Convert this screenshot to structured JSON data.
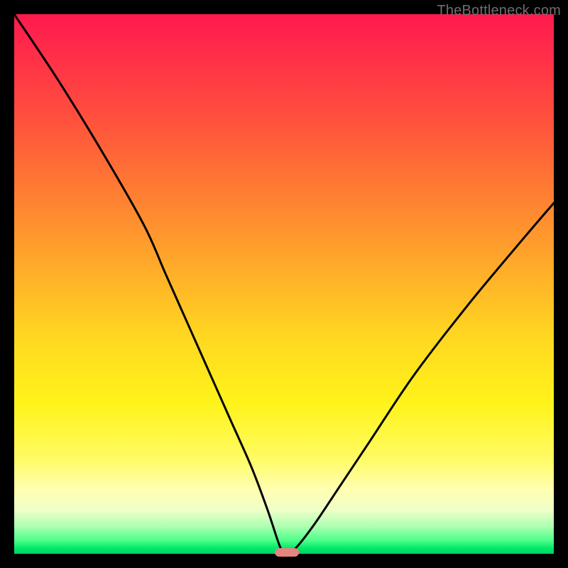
{
  "watermark": "TheBottleneck.com",
  "chart_data": {
    "type": "line",
    "title": "",
    "xlabel": "",
    "ylabel": "",
    "xlim": [
      0,
      100
    ],
    "ylim": [
      0,
      100
    ],
    "grid": false,
    "series": [
      {
        "name": "bottleneck-curve",
        "x": [
          0,
          8,
          16,
          24,
          28,
          32,
          36,
          40,
          44,
          47,
          49,
          50,
          51,
          53,
          56,
          60,
          66,
          74,
          84,
          94,
          100
        ],
        "values": [
          100,
          88,
          75,
          61,
          52,
          43,
          34,
          25,
          16,
          8,
          2,
          0,
          0,
          2,
          6,
          12,
          21,
          33,
          46,
          58,
          65
        ]
      }
    ],
    "ideal_point": {
      "x": 50.5,
      "y": 0
    },
    "gradient_stops": [
      {
        "pos": 0.0,
        "color": "#ff1a4d"
      },
      {
        "pos": 0.18,
        "color": "#ff4c3e"
      },
      {
        "pos": 0.46,
        "color": "#ffa82a"
      },
      {
        "pos": 0.72,
        "color": "#fff31a"
      },
      {
        "pos": 0.92,
        "color": "#eeffc8"
      },
      {
        "pos": 1.0,
        "color": "#00d45f"
      }
    ]
  }
}
